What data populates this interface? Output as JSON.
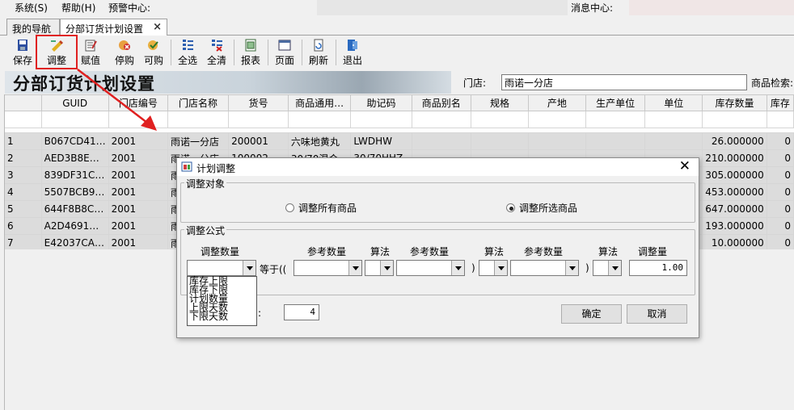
{
  "menu": {
    "system": "系统(S)",
    "help": "帮助(H)",
    "alert": "预警中心:",
    "message": "消息中心:"
  },
  "tabs": [
    {
      "label": "我的导航"
    },
    {
      "label": "分部订货计划设置"
    }
  ],
  "toolbar": [
    {
      "label": "保存",
      "icon": "save-icon"
    },
    {
      "label": "调整",
      "icon": "adjust-icon"
    },
    {
      "label": "赋值",
      "icon": "assign-icon"
    },
    {
      "label": "停购",
      "icon": "stop-purchase-icon"
    },
    {
      "label": "可购",
      "icon": "allow-purchase-icon"
    },
    {
      "label": "全选",
      "icon": "select-all-icon"
    },
    {
      "label": "全清",
      "icon": "clear-all-icon"
    },
    {
      "label": "报表",
      "icon": "report-icon"
    },
    {
      "label": "页面",
      "icon": "page-icon"
    },
    {
      "label": "刷新",
      "icon": "refresh-icon"
    },
    {
      "label": "退出",
      "icon": "exit-icon"
    }
  ],
  "page": {
    "title": "分部订货计划设置",
    "store_label": "门店:",
    "store_value": "雨诺一分店",
    "search_label": "商品检索:"
  },
  "grid": {
    "columns": [
      "GUID",
      "门店编号",
      "门店名称",
      "货号",
      "商品通用…",
      "助记码",
      "商品别名",
      "规格",
      "产地",
      "生产单位",
      "单位",
      "库存数量",
      "库存"
    ],
    "rows": [
      {
        "n": "1",
        "guid": "B067CD41…",
        "store_no": "2001",
        "store_name": "雨诺一分店",
        "sku": "200001",
        "generic": "六味地黄丸",
        "mnemonic": "LWDHW",
        "stock": "26.000000",
        "last": "0"
      },
      {
        "n": "2",
        "guid": "AED3B8E…",
        "store_no": "2001",
        "store_name": "雨诺一分店",
        "sku": "100002",
        "generic": "30/70混合…",
        "mnemonic": "30/70HHZ",
        "stock": "210.000000",
        "last": "0"
      },
      {
        "n": "3",
        "guid": "839DF31C…",
        "store_no": "2001",
        "store_name": "雨",
        "sku": "",
        "generic": "",
        "mnemonic": "",
        "stock": "305.000000",
        "last": "0"
      },
      {
        "n": "4",
        "guid": "5507BCB9…",
        "store_no": "2001",
        "store_name": "雨",
        "sku": "",
        "generic": "",
        "mnemonic": "",
        "stock": "453.000000",
        "last": "0"
      },
      {
        "n": "5",
        "guid": "644F8B8C…",
        "store_no": "2001",
        "store_name": "雨",
        "sku": "",
        "generic": "",
        "mnemonic": "",
        "stock": "647.000000",
        "last": "0"
      },
      {
        "n": "6",
        "guid": "A2D4691…",
        "store_no": "2001",
        "store_name": "雨",
        "sku": "",
        "generic": "",
        "mnemonic": "",
        "stock": "193.000000",
        "last": "0"
      },
      {
        "n": "7",
        "guid": "E42037CA…",
        "store_no": "2001",
        "store_name": "雨",
        "sku": "",
        "generic": "",
        "mnemonic": "",
        "stock": "10.000000",
        "last": "0"
      }
    ]
  },
  "dialog": {
    "title": "计划调整",
    "target_group": "调整对象",
    "radio_all": "调整所有商品",
    "radio_selected": "调整所选商品",
    "formula_group": "调整公式",
    "h_adjust_qty": "调整数量",
    "h_ref_qty1": "参考数量",
    "h_op1": "算法",
    "h_ref_qty2": "参考数量",
    "h_op2": "算法",
    "h_ref_qty3": "参考数量",
    "h_op3": "算法",
    "h_adjust_amount": "调整量",
    "equals": "等于((",
    "paren1": ")",
    "paren2": ")",
    "adjust_value": "1.00",
    "colon": ":",
    "days_value": "4",
    "ok": "确定",
    "cancel": "取消",
    "dropdown_options": [
      "库存上限",
      "库存下限",
      "计划数量",
      "上限天数",
      "下限天数"
    ]
  },
  "colors": {
    "highlight": "#e02020",
    "arrow": "#e02020",
    "row_bg": "#dcdcdc"
  }
}
